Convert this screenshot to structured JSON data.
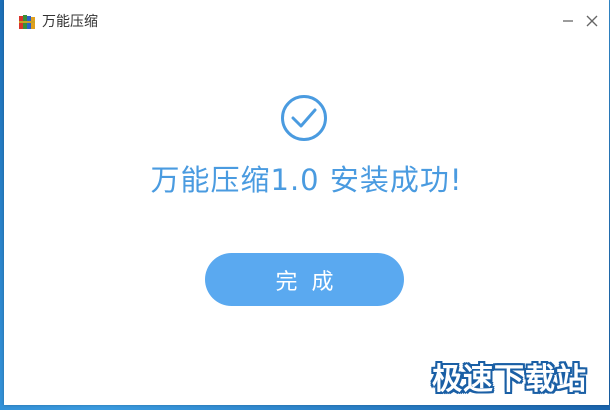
{
  "window": {
    "title": "万能压缩"
  },
  "titlebar": {
    "app_icon": "archive-books-icon",
    "minimize_icon": "minimize-icon",
    "close_icon": "close-icon"
  },
  "main": {
    "status_icon": "check-circle-icon",
    "success_message": "万能压缩1.0 安装成功!",
    "done_label": "完成"
  },
  "watermark": {
    "text": "极速下载站"
  },
  "colors": {
    "accent": "#4a9be0",
    "button_bg": "#5aa9f0",
    "desktop_blue": "#1c6fb8"
  }
}
